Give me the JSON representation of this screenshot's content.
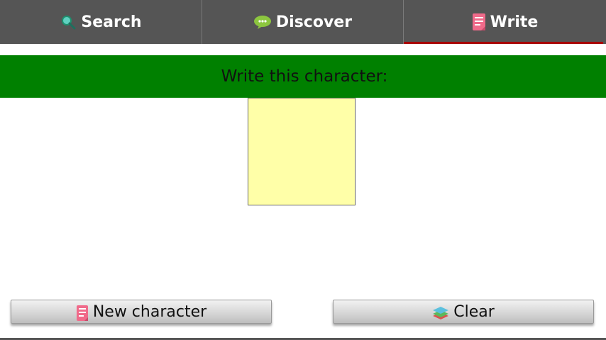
{
  "tabs": [
    {
      "label": "Search",
      "icon": "magnifier-icon",
      "active": false
    },
    {
      "label": "Discover",
      "icon": "speech-bubble-icon",
      "active": false
    },
    {
      "label": "Write",
      "icon": "note-icon",
      "active": true
    }
  ],
  "prompt": {
    "text": "Write this character:"
  },
  "buttons": {
    "new_character": "New character",
    "clear": "Clear"
  },
  "colors": {
    "tabbar": "#555555",
    "active_indicator": "#a80000",
    "prompt_bar": "#008000",
    "canvas": "#ffffa8"
  }
}
